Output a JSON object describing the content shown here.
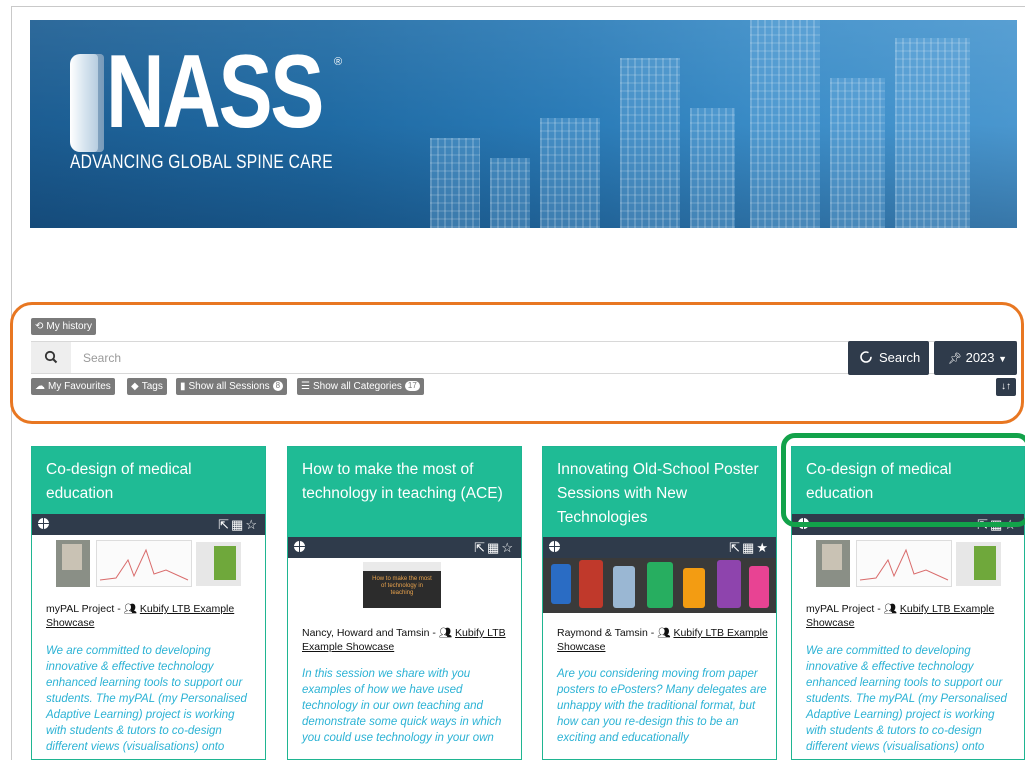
{
  "banner": {
    "logo_text": "NASS",
    "logo_reg": "®",
    "tagline": "ADVANCING GLOBAL SPINE CARE"
  },
  "toolbar": {
    "history_label": "My history",
    "search_placeholder": "Search",
    "search_button": "Search",
    "year_button": "2023",
    "favourites_label": "My Favourites",
    "tags_label": "Tags",
    "sessions_label": "Show all Sessions",
    "sessions_count": "8",
    "categories_label": "Show all Categories",
    "categories_count": "17"
  },
  "cards": [
    {
      "title": "Co-design of medical education",
      "author_prefix": "myPAL Project - ",
      "author_link": "Kubify LTB Example Showcase",
      "description": "We are committed to developing innovative & effective technology enhanced learning tools to support our students. The myPAL (my Personalised Adaptive Learning) project is working with students & tutors to co-design different views (visualisations) onto"
    },
    {
      "title": "How to make the most of technology in teaching (ACE)",
      "author_prefix": "Nancy, Howard and Tamsin - ",
      "author_link": "Kubify LTB Example Showcase",
      "thumb_text": "How to make the most of technology in teaching",
      "description": "In this session we share with you examples of how we have used technology in our own teaching and demonstrate some quick ways in which you could use technology in your own"
    },
    {
      "title": "Innovating Old-School Poster Sessions with New Technologies",
      "author_prefix": "Raymond & Tamsin - ",
      "author_link": "Kubify LTB Example Showcase",
      "description": "Are you considering moving from paper posters to ePosters? Many delegates are unhappy with the traditional format, but how can you re-design this to be an exciting and educationally"
    },
    {
      "title": "Co-design of medical education",
      "author_prefix": "myPAL Project - ",
      "author_link": "Kubify LTB Example Showcase",
      "description": "We are committed to developing innovative & effective technology enhanced learning tools to support our students. The myPAL (my Personalised Adaptive Learning) project is working with students & tutors to co-design different views (visualisations) onto"
    }
  ],
  "colors": {
    "accent_green": "#1fbb95",
    "dark_bar": "#2f3b4b",
    "highlight_orange": "#e87722",
    "highlight_green": "#12a24a",
    "description_blue": "#2bb2d4"
  }
}
